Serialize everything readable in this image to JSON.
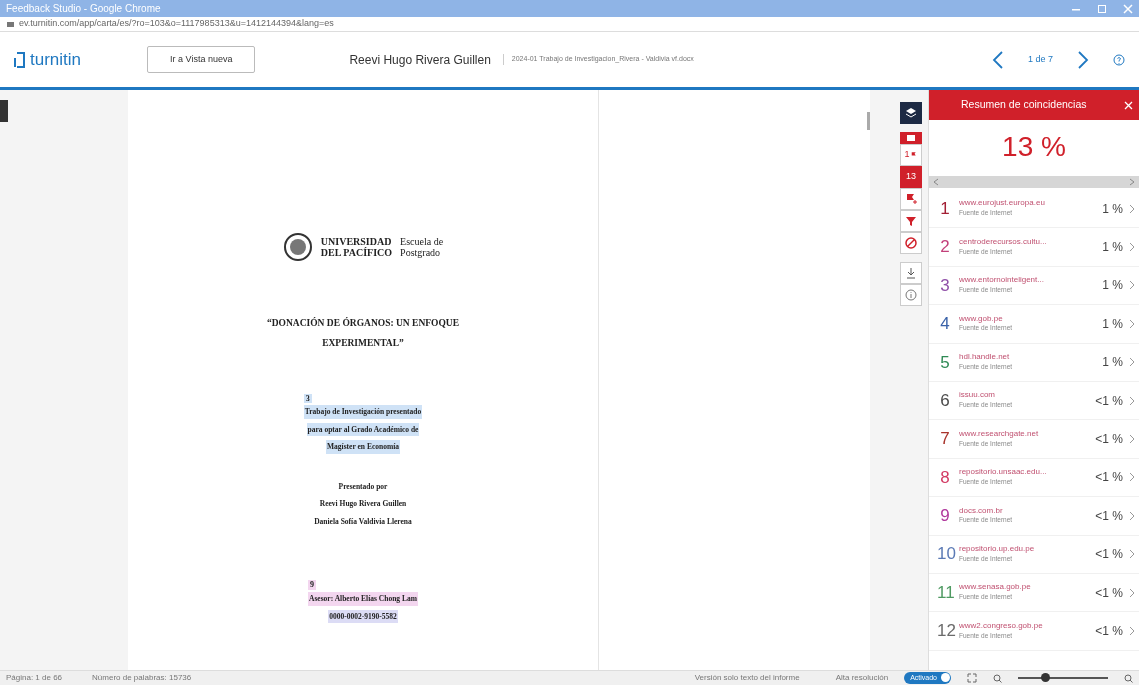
{
  "window": {
    "title": "Feedback Studio - Google Chrome",
    "url": "ev.turnitin.com/app/carta/es/?ro=103&o=1117985313&u=1412144394&lang=es"
  },
  "header": {
    "logo": "turnitin",
    "new_view_button": "Ir a Vista nueva",
    "author": "Reevi Hugo Rivera Guillen",
    "file": "2024-01 Trabajo de Investigacion_Rivera - Valdivia vf.docx",
    "pager": "1 de 7"
  },
  "document": {
    "university": [
      "UNIVERSIDAD",
      "DEL PACÍFICO"
    ],
    "school": [
      "Escuela de",
      "Postgrado"
    ],
    "title": [
      "“DONACIÓN DE ÓRGANOS: UN ENFOQUE",
      "EXPERIMENTAL”"
    ],
    "lines": [
      {
        "text": "Trabajo de Investigación presentado",
        "color": "#cfe2f6",
        "marker": "3"
      },
      {
        "text": "para optar al Grado Académico de",
        "color": "#cfe2f6"
      },
      {
        "text": "Magíster en Economía",
        "color": "#cfe2f6"
      },
      {
        "text": "Presentado por"
      },
      {
        "text": "Reevi Hugo Rivera Guillen"
      },
      {
        "text": "Daniela Sofía Valdivia Llerena"
      },
      {
        "text": "Asesor: Alberto Elías Chong Lam",
        "color": "#f3d6ef",
        "marker": "9"
      },
      {
        "text": "0000-0002-9190-5582",
        "color": "#dcdcf5"
      }
    ]
  },
  "tools": [
    {
      "kind": "layers",
      "selected": false
    },
    {
      "kind": "top",
      "selected": false
    },
    {
      "kind": "flag",
      "label": "1",
      "selected": false
    },
    {
      "kind": "count",
      "label": "13",
      "selected": true
    },
    {
      "kind": "flagplus",
      "selected": false
    },
    {
      "kind": "filter",
      "selected": false
    },
    {
      "kind": "block",
      "selected": false
    },
    {
      "kind": "download",
      "selected": false
    },
    {
      "kind": "info",
      "selected": false
    }
  ],
  "panel": {
    "title": "Resumen de coincidencias",
    "score": "13 %",
    "matches": [
      {
        "number": "1",
        "source": "www.eurojust.europa.eu",
        "type": "Fuente de Internet",
        "percent": "1 %",
        "color": "#a31f34"
      },
      {
        "number": "2",
        "source": "centroderecursos.cultu...",
        "type": "Fuente de Internet",
        "percent": "1 %",
        "color": "#c2407a"
      },
      {
        "number": "3",
        "source": "www.entornointeligent...",
        "type": "Fuente de Internet",
        "percent": "1 %",
        "color": "#9050a8"
      },
      {
        "number": "4",
        "source": "www.gob.pe",
        "type": "Fuente de Internet",
        "percent": "1 %",
        "color": "#3a62a8"
      },
      {
        "number": "5",
        "source": "hdl.handle.net",
        "type": "Fuente de Internet",
        "percent": "1 %",
        "color": "#2f8a55"
      },
      {
        "number": "6",
        "source": "issuu.com",
        "type": "Fuente de Internet",
        "percent": "<1 %",
        "color": "#4a4a4a"
      },
      {
        "number": "7",
        "source": "www.researchgate.net",
        "type": "Fuente de Internet",
        "percent": "<1 %",
        "color": "#a8342c"
      },
      {
        "number": "8",
        "source": "repositorio.unsaac.edu...",
        "type": "Fuente de Internet",
        "percent": "<1 %",
        "color": "#d23a63"
      },
      {
        "number": "9",
        "source": "docs.com.br",
        "type": "Fuente de Internet",
        "percent": "<1 %",
        "color": "#b0389c"
      },
      {
        "number": "10",
        "source": "repositorio.up.edu.pe",
        "type": "Fuente de Internet",
        "percent": "<1 %",
        "color": "#5b7ab5"
      },
      {
        "number": "11",
        "source": "www.senasa.gob.pe",
        "type": "Fuente de Internet",
        "percent": "<1 %",
        "color": "#4f9a62"
      },
      {
        "number": "12",
        "source": "www2.congreso.gob.pe",
        "type": "Fuente de Internet",
        "percent": "<1 %",
        "color": "#6b6b6b"
      }
    ]
  },
  "status_bar": {
    "page": "Página: 1 de 66",
    "words": "Número de palabras: 15736",
    "text_only": "Versión solo texto del informe",
    "high_res": "Alta resolución",
    "toggle": {
      "label": "Activado",
      "on": true
    },
    "zoom": {
      "level": 0.3
    }
  }
}
